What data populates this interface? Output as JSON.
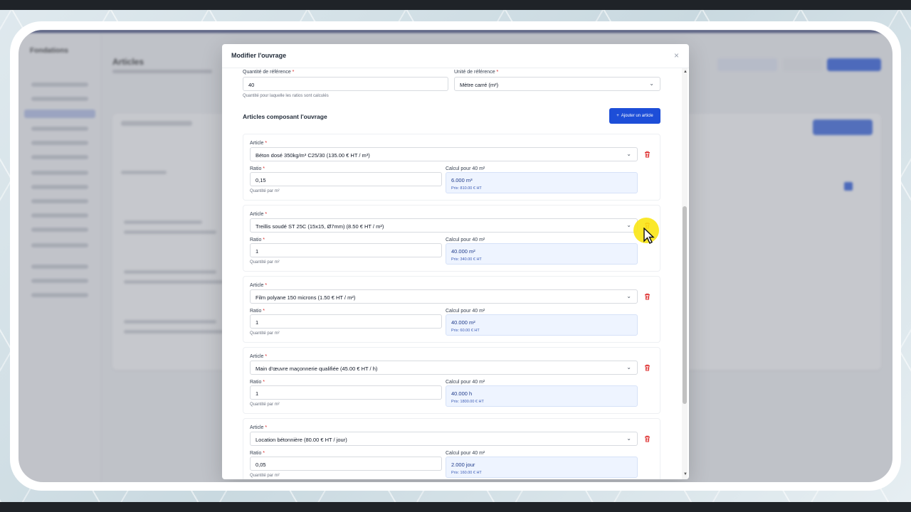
{
  "app": {
    "brand": "Fondations",
    "page_title": "Articles"
  },
  "modal": {
    "title": "Modifier l'ouvrage",
    "close_glyph": "×",
    "reference_quantity": {
      "label": "Quantité de référence",
      "required": "*",
      "value": "40",
      "hint": "Quantité pour laquelle les ratios sont calculés"
    },
    "reference_unit": {
      "label": "Unité de référence",
      "required": "*",
      "value": "Mètre carré (m²)"
    },
    "section_title": "Articles composant l'ouvrage",
    "add_button": {
      "icon": "+",
      "label": "Ajouter un article"
    },
    "items": [
      {
        "article_label": "Article",
        "article_value": "Béton dosé 350kg/m³ C25/30 (135.00 € HT / m³)",
        "ratio_label": "Ratio",
        "ratio_value": "0,15",
        "ratio_hint": "Quantité par m²",
        "calc_label": "Calcul pour 40 m²",
        "calc_value": "6.000 m³",
        "calc_price": "Prix: 810.00 € HT"
      },
      {
        "article_label": "Article",
        "article_value": "Treillis soudé ST 25C (15x15, Ø7mm) (8.50 € HT / m²)",
        "ratio_label": "Ratio",
        "ratio_value": "1",
        "ratio_hint": "Quantité par m²",
        "calc_label": "Calcul pour 40 m²",
        "calc_value": "40.000 m²",
        "calc_price": "Prix: 340.00 € HT"
      },
      {
        "article_label": "Article",
        "article_value": "Film polyane 150 microns (1.50 € HT / m²)",
        "ratio_label": "Ratio",
        "ratio_value": "1",
        "ratio_hint": "Quantité par m²",
        "calc_label": "Calcul pour 40 m²",
        "calc_value": "40.000 m²",
        "calc_price": "Prix: 60.00 € HT"
      },
      {
        "article_label": "Article",
        "article_value": "Main d'œuvre maçonnerie qualifiée (45.00 € HT / h)",
        "ratio_label": "Ratio",
        "ratio_value": "1",
        "ratio_hint": "Quantité par m²",
        "calc_label": "Calcul pour 40 m²",
        "calc_value": "40.000 h",
        "calc_price": "Prix: 1800.00 € HT"
      },
      {
        "article_label": "Article",
        "article_value": "Location bétonnière (80.00 € HT / jour)",
        "ratio_label": "Ratio",
        "ratio_value": "0,05",
        "ratio_hint": "Quantité par m²",
        "calc_label": "Calcul pour 40 m²",
        "calc_value": "2.000 jour",
        "calc_price": "Prix: 160.00 € HT"
      }
    ],
    "required_mark": "*",
    "chevron_glyph": "⌄",
    "trash_glyph": "🗑"
  },
  "colors": {
    "primary": "#1d4ed8",
    "danger": "#dc2626",
    "calc_bg": "#eef4ff",
    "cursor_highlight": "#fae614"
  },
  "icons": [
    "close-icon",
    "chevron-down-icon",
    "trash-icon",
    "plus-icon",
    "cursor-icon"
  ]
}
